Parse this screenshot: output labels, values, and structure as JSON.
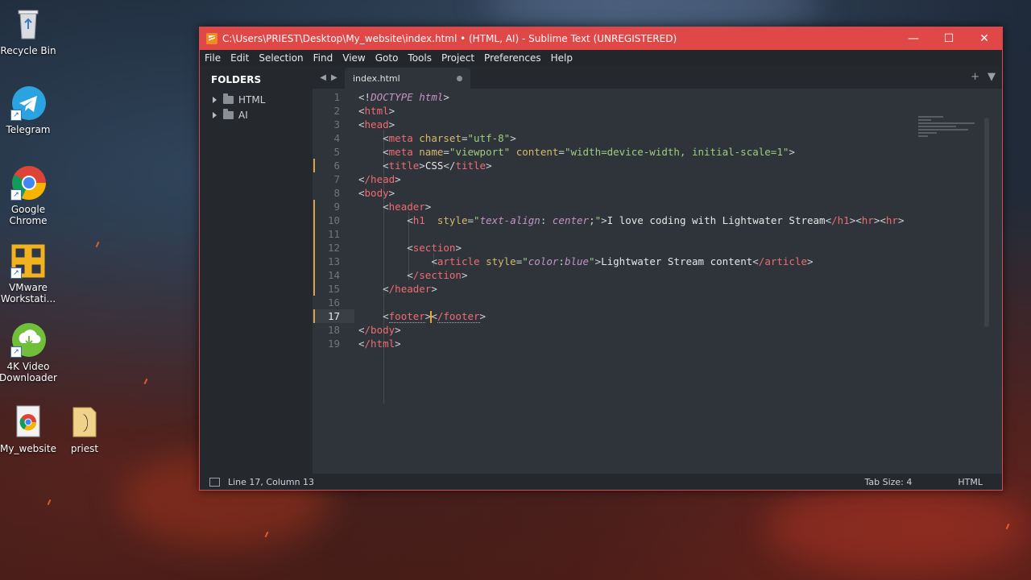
{
  "desktop": {
    "icons": [
      {
        "label_line1": "Recycle Bin",
        "label_line2": ""
      },
      {
        "label_line1": "Telegram",
        "label_line2": ""
      },
      {
        "label_line1": "Google",
        "label_line2": "Chrome"
      },
      {
        "label_line1": "VMware",
        "label_line2": "Workstati..."
      },
      {
        "label_line1": "4K Video",
        "label_line2": "Downloader"
      },
      {
        "label_line1": "My_website",
        "label_line2": ""
      },
      {
        "label_line1": "priest",
        "label_line2": ""
      }
    ]
  },
  "window": {
    "title": "C:\\Users\\PRIEST\\Desktop\\My_website\\index.html • (HTML, AI) - Sublime Text (UNREGISTERED)",
    "controls": {
      "minimize": "—",
      "maximize": "☐",
      "close": "✕"
    },
    "menu": [
      "File",
      "Edit",
      "Selection",
      "Find",
      "View",
      "Goto",
      "Tools",
      "Project",
      "Preferences",
      "Help"
    ]
  },
  "sidebar": {
    "title": "FOLDERS",
    "folders": [
      "HTML",
      "AI"
    ]
  },
  "tab": {
    "name": "index.html",
    "tools": {
      "add": "+",
      "dropdown": "▼"
    },
    "nav": {
      "back": "◀",
      "forward": "▶"
    }
  },
  "editor": {
    "lines": [
      {
        "num": "1"
      },
      {
        "num": "2"
      },
      {
        "num": "3"
      },
      {
        "num": "4"
      },
      {
        "num": "5"
      },
      {
        "num": "6"
      },
      {
        "num": "7"
      },
      {
        "num": "8"
      },
      {
        "num": "9"
      },
      {
        "num": "10"
      },
      {
        "num": "11"
      },
      {
        "num": "12"
      },
      {
        "num": "13"
      },
      {
        "num": "14"
      },
      {
        "num": "15"
      },
      {
        "num": "16"
      },
      {
        "num": "17"
      },
      {
        "num": "18"
      },
      {
        "num": "19"
      }
    ],
    "code": {
      "l1_a": "<!",
      "l1_doctype": "DOCTYPE",
      "l1_sp": " ",
      "l1_html": "html",
      "l1_b": ">",
      "l2_tag": "html",
      "l3_tag": "head",
      "l4_tag": "meta",
      "l4_attr": "charset",
      "l4_val": "\"utf-8\"",
      "l5_tag": "meta",
      "l5_attr1": "name",
      "l5_val1": "\"viewport\"",
      "l5_attr2": "content",
      "l5_val2": "\"width=device-width, initial-scale=1\"",
      "l6_tag": "title",
      "l6_text": "CSS",
      "l7_tag": "/head",
      "l8_tag": "body",
      "l9_tag": "header",
      "l10_tag": "h1",
      "l10_attr": "style",
      "l10_q1": "\"",
      "l10_prop": "text-align",
      "l10_colon": ": ",
      "l10_value": "center",
      "l10_semi": ";",
      "l10_q2": "\"",
      "l10_text": "I love coding with Lightwater Stream",
      "l10_close": "/h1",
      "l10_hr1": "hr",
      "l10_hr2": "hr",
      "l12_tag": "section",
      "l13_tag": "article",
      "l13_attr": "style",
      "l13_q1": "\"",
      "l13_prop": "color",
      "l13_colon": ":",
      "l13_value": "blue",
      "l13_q2": "\"",
      "l13_text": "Lightwater Stream content",
      "l13_close": "/article",
      "l14_tag": "/section",
      "l15_tag": "/header",
      "l17_tag": "footer",
      "l17_close": "/footer",
      "l18_tag": "/body",
      "l19_tag": "/html"
    }
  },
  "status": {
    "position": "Line 17, Column 13",
    "tab_size": "Tab Size: 4",
    "syntax": "HTML"
  },
  "colors": {
    "titlebar": "#e04848",
    "tag": "#ef6b73",
    "attribute": "#d7b96a",
    "string": "#9cce7e",
    "keyword": "#c594c5",
    "cursor": "#f0a030"
  }
}
